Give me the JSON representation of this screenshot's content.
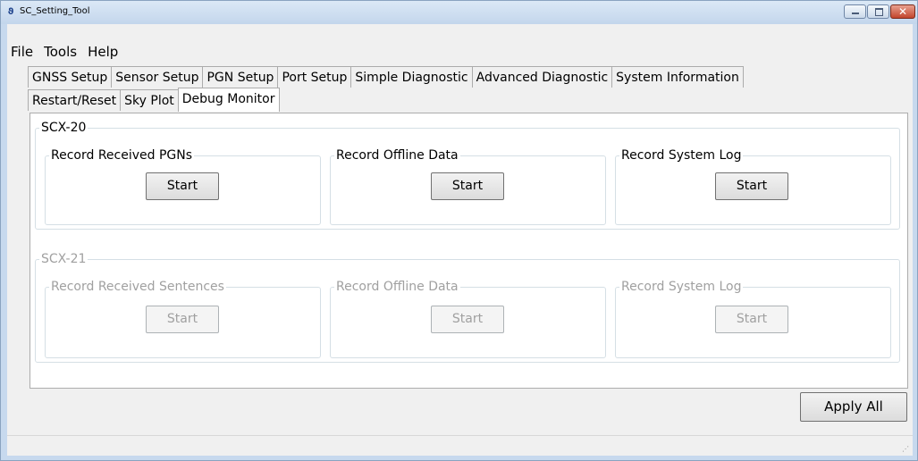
{
  "window": {
    "title": "SC_Setting_Tool"
  },
  "menu": [
    "File",
    "Tools",
    "Help"
  ],
  "tabs_row1": [
    "GNSS Setup",
    "Sensor Setup",
    "PGN Setup",
    "Port Setup",
    "Simple Diagnostic",
    "Advanced Diagnostic",
    "System Information"
  ],
  "tabs_row2": [
    "Restart/Reset",
    "Sky Plot",
    "Debug Monitor"
  ],
  "active_tab": "Debug Monitor",
  "scx20": {
    "title": "SCX-20",
    "enabled": true,
    "groups": [
      {
        "title": "Record Received PGNs",
        "button": "Start"
      },
      {
        "title": "Record Offline Data",
        "button": "Start"
      },
      {
        "title": "Record System Log",
        "button": "Start"
      }
    ]
  },
  "scx21": {
    "title": "SCX-21",
    "enabled": false,
    "groups": [
      {
        "title": "Record Received Sentences",
        "button": "Start"
      },
      {
        "title": "Record Offline Data",
        "button": "Start"
      },
      {
        "title": "Record System Log",
        "button": "Start"
      }
    ]
  },
  "apply_all": "Apply All",
  "icons": {
    "app": "app-icon",
    "minimize": "minimize-icon",
    "maximize": "maximize-icon",
    "close": "close-icon",
    "grip": "resize-grip-icon"
  }
}
